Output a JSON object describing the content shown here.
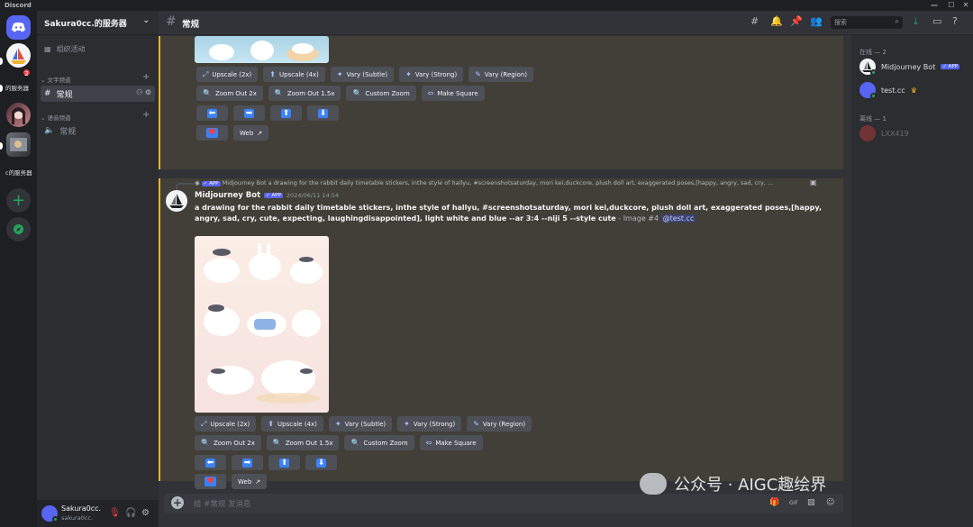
{
  "titlebar": {
    "app_name": "Discord",
    "min": "—",
    "max": "☐",
    "close": "✕"
  },
  "rail": {
    "servers": [
      {
        "label": "Discord Home",
        "icon": "discord-logo-icon"
      },
      {
        "label": "的服务器",
        "badge": "2"
      },
      {
        "label": ""
      },
      {
        "label": ""
      },
      {
        "label": "c的服务器"
      }
    ],
    "add_icon": "+",
    "explore_icon": "✱"
  },
  "sidebar": {
    "guild_name": "Sakura0cc.的服务器",
    "events_label": "组织活动",
    "categories": [
      {
        "label": "文字频道",
        "channels": [
          {
            "name": "常规",
            "active": true
          }
        ]
      },
      {
        "label": "语音频道",
        "channels": [
          {
            "name": "常规",
            "active": false
          }
        ]
      }
    ]
  },
  "user": {
    "name": "Sakura0cc.",
    "tag": "sakura0cc."
  },
  "header": {
    "channel": "常规",
    "search_placeholder": "搜索"
  },
  "messages": {
    "buttons_row1": [
      {
        "icon": "⤢",
        "label": "Upscale (2x)"
      },
      {
        "icon": "⬆",
        "label": "Upscale (4x)"
      },
      {
        "icon": "✦",
        "label": "Vary (Subtle)"
      },
      {
        "icon": "✦",
        "label": "Vary (Strong)"
      },
      {
        "icon": "✎",
        "label": "Vary (Region)"
      }
    ],
    "buttons_row2": [
      {
        "icon": "🔍",
        "label": "Zoom Out 2x"
      },
      {
        "icon": "🔍",
        "label": "Zoom Out 1.5x"
      },
      {
        "icon": "🔍",
        "label": "Custom Zoom"
      },
      {
        "icon": "⇔",
        "label": "Make Square"
      }
    ],
    "arrows": [
      "⬅",
      "➡",
      "⬆",
      "⬇"
    ],
    "heart": "♥",
    "web": "Web",
    "reply_app": "✓ APP",
    "reply_text": "Midjourney Bot a drawing for the rabbit daily timetable stickers, inthe style of hallyu, #screenshotsaturday, mori kei,duckcore, plush doll art, exaggerated poses,[happy, angry, sad, cry, ...",
    "author": "Midjourney Bot",
    "author_app": "✓ APP",
    "timestamp": "2024/06/11 14:54",
    "prompt": "a drawing for the rabbit daily timetable stickers, inthe style of hallyu, #screenshotsaturday, mori kei,duckcore, plush doll art, exaggerated poses,[happy, angry, sad, cry, cute, expecting, laughingdisappointed], light white and blue --ar 3:4 --niji 5 --style cute",
    "suffix": " - Image #4 ",
    "mention": "@test.cc"
  },
  "composer": {
    "placeholder": "给 #常规 发消息"
  },
  "members": {
    "online_label": "在线 — 2",
    "offline_label": "离线 — 1",
    "online": [
      {
        "name": "Midjourney Bot",
        "app": "✓ APP"
      },
      {
        "name": "test.cc",
        "crown": "♛"
      }
    ],
    "offline": [
      {
        "name": "LXX419"
      }
    ]
  },
  "watermark": "公众号 · AIGC趣绘界",
  "colors": {
    "accent": "#5865f2",
    "highlight_border": "#f0b232",
    "online": "#23a55a"
  }
}
